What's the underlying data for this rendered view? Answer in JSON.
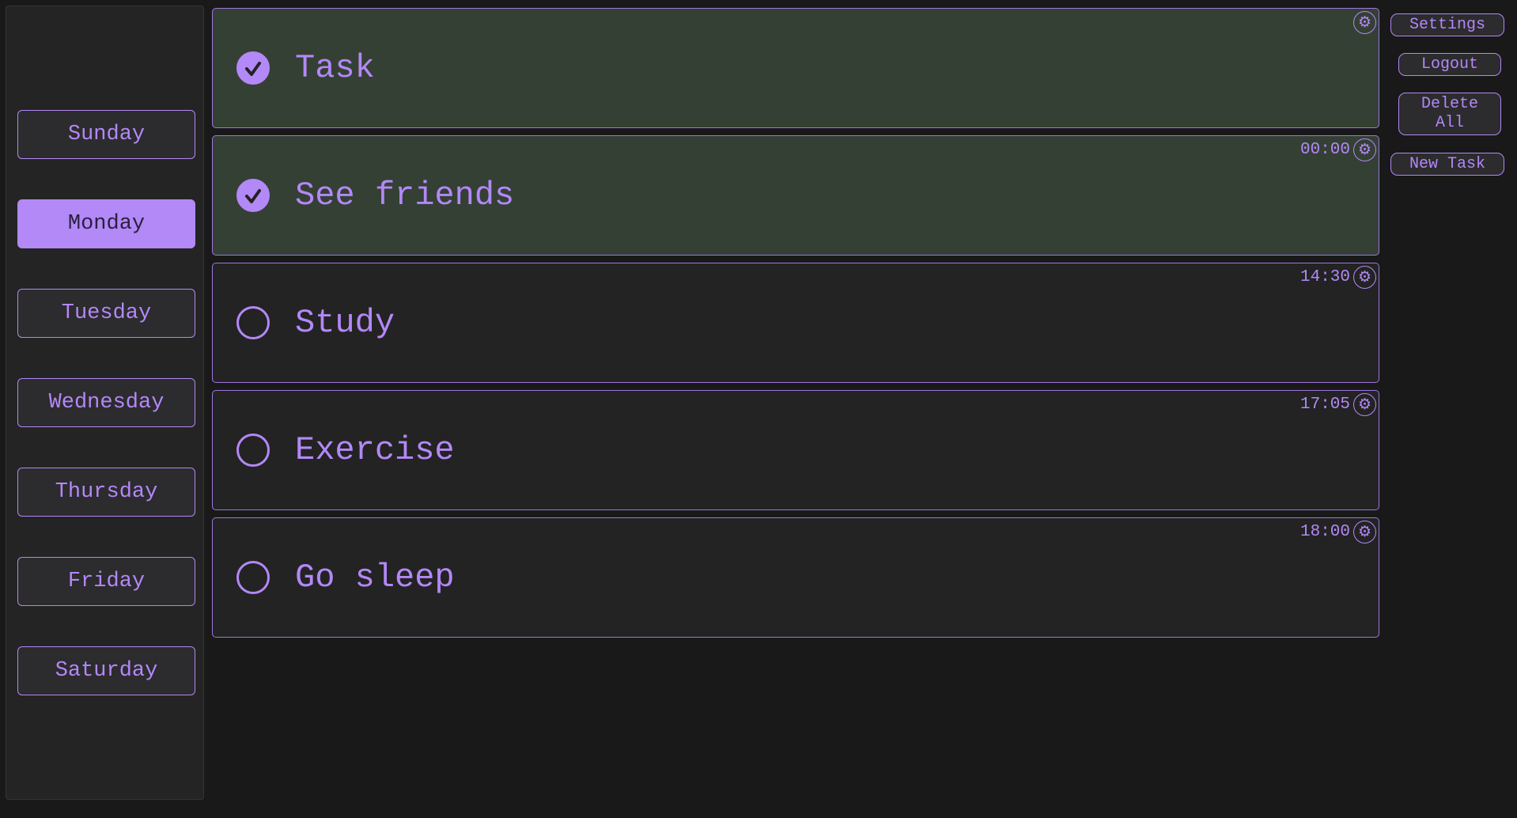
{
  "days": {
    "items": [
      {
        "label": "Sunday",
        "active": false
      },
      {
        "label": "Monday",
        "active": true
      },
      {
        "label": "Tuesday",
        "active": false
      },
      {
        "label": "Wednesday",
        "active": false
      },
      {
        "label": "Thursday",
        "active": false
      },
      {
        "label": "Friday",
        "active": false
      },
      {
        "label": "Saturday",
        "active": false
      }
    ]
  },
  "tasks": [
    {
      "title": "Task",
      "time": "",
      "done": true
    },
    {
      "title": "See friends",
      "time": "00:00",
      "done": true
    },
    {
      "title": "Study",
      "time": "14:30",
      "done": false
    },
    {
      "title": "Exercise",
      "time": "17:05",
      "done": false
    },
    {
      "title": "Go sleep",
      "time": "18:00",
      "done": false
    }
  ],
  "actions": {
    "settings_label": "Settings",
    "logout_label": "Logout",
    "delete_all_label": "Delete All",
    "new_task_label": "New Task"
  },
  "icons": {
    "check": "check-circle-icon",
    "empty": "empty-circle-icon",
    "gear": "gear-icon",
    "gear_glyph": "⚙"
  },
  "colors": {
    "accent": "#b388f7",
    "background": "#191919",
    "panel": "#242424",
    "done_task_bg": "#344034"
  }
}
